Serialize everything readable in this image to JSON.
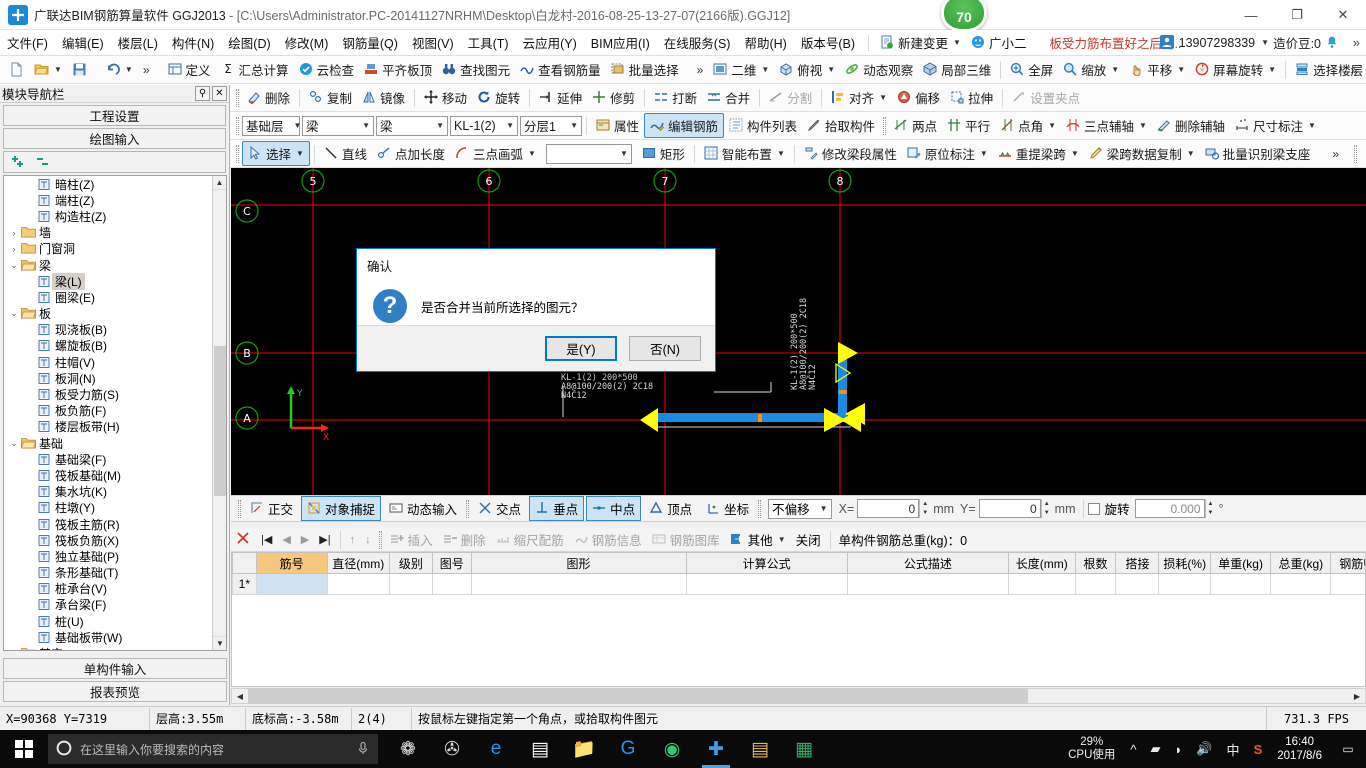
{
  "window": {
    "title_main": "广联达BIM钢筋算量软件 GGJ2013",
    "title_path": " - [C:\\Users\\Administrator.PC-20141127NRHM\\Desktop\\白龙村-2016-08-25-13-27-07(2166版).GGJ12]",
    "minimize": "—",
    "maximize": "❐",
    "close": "✕",
    "score_badge": "70"
  },
  "menu": {
    "items": [
      {
        "label": "文件(F)"
      },
      {
        "label": "编辑(E)"
      },
      {
        "label": "楼层(L)"
      },
      {
        "label": "构件(N)"
      },
      {
        "label": "绘图(D)"
      },
      {
        "label": "修改(M)"
      },
      {
        "label": "钢筋量(Q)"
      },
      {
        "label": "视图(V)"
      },
      {
        "label": "工具(T)"
      },
      {
        "label": "云应用(Y)"
      },
      {
        "label": "BIM应用(I)"
      },
      {
        "label": "在线服务(S)"
      },
      {
        "label": "帮助(H)"
      },
      {
        "label": "版本号(B)"
      }
    ],
    "new_change": "新建变更",
    "user_nick": "广小二",
    "ad_text": "板受力筋布置好之后再..",
    "account_phone": "13907298339",
    "coin_label": "造价豆:0",
    "overflow": "»"
  },
  "toolbar1": {
    "overflow_left": "»",
    "items": [
      {
        "label": "定义",
        "icon": "define-icon"
      },
      {
        "label": "汇总计算",
        "icon": "sigma-icon"
      },
      {
        "label": "云检查",
        "icon": "cloud-check-icon"
      },
      {
        "label": "平齐板顶",
        "icon": "align-slab-icon"
      },
      {
        "label": "查找图元",
        "icon": "binocular-icon"
      },
      {
        "label": "查看钢筋量",
        "icon": "view-rebar-icon"
      },
      {
        "label": "批量选择",
        "icon": "batch-select-icon"
      }
    ],
    "view_items": [
      {
        "label": "二维",
        "icon": "2d-icon",
        "has_caret": true
      },
      {
        "label": "俯视",
        "icon": "topview-icon",
        "has_caret": true
      },
      {
        "label": "动态观察",
        "icon": "orbit-icon",
        "has_caret": false
      },
      {
        "label": "局部三维",
        "icon": "local3d-icon",
        "has_caret": false
      },
      {
        "label": "全屏",
        "icon": "fullscreen-icon",
        "has_caret": false
      },
      {
        "label": "缩放",
        "icon": "zoom-icon",
        "has_caret": true
      },
      {
        "label": "平移",
        "icon": "pan-icon",
        "has_caret": true
      },
      {
        "label": "屏幕旋转",
        "icon": "screen-rotate-icon",
        "has_caret": true
      },
      {
        "label": "选择楼层",
        "icon": "select-floor-icon",
        "has_caret": false
      }
    ],
    "overflow_right": "»"
  },
  "toolbar2": {
    "items": [
      {
        "label": "删除",
        "icon": "delete-icon",
        "disabled": false
      },
      {
        "label": "复制",
        "icon": "copy-icon",
        "disabled": false
      },
      {
        "label": "镜像",
        "icon": "mirror-icon",
        "disabled": false
      },
      {
        "label": "移动",
        "icon": "move-icon",
        "disabled": false
      },
      {
        "label": "旋转",
        "icon": "rotate-icon",
        "disabled": false
      },
      {
        "label": "延伸",
        "icon": "extend-icon",
        "disabled": false
      },
      {
        "label": "修剪",
        "icon": "trim-icon",
        "disabled": false
      },
      {
        "label": "打断",
        "icon": "break-icon",
        "disabled": false
      },
      {
        "label": "合并",
        "icon": "merge-icon",
        "disabled": false
      },
      {
        "label": "分割",
        "icon": "split-icon",
        "disabled": true
      },
      {
        "label": "对齐",
        "icon": "align-icon",
        "disabled": false,
        "has_caret": true
      },
      {
        "label": "偏移",
        "icon": "offset-icon",
        "disabled": false
      },
      {
        "label": "拉伸",
        "icon": "stretch-icon",
        "disabled": false
      },
      {
        "label": "设置夹点",
        "icon": "grip-set-icon",
        "disabled": true
      }
    ]
  },
  "toolbar3": {
    "selects": [
      {
        "name": "floor-select",
        "value": "基础层"
      },
      {
        "name": "category-select",
        "value": "梁"
      },
      {
        "name": "type-select",
        "value": "梁"
      },
      {
        "name": "component-select",
        "value": "KL-1(2)"
      },
      {
        "name": "layer-select",
        "value": "分层1"
      }
    ],
    "items": [
      {
        "label": "属性",
        "icon": "property-icon",
        "active": false
      },
      {
        "label": "编辑钢筋",
        "icon": "edit-rebar-icon",
        "active": true
      },
      {
        "label": "构件列表",
        "icon": "component-list-icon",
        "active": false
      },
      {
        "label": "拾取构件",
        "icon": "pick-component-icon",
        "active": false
      },
      {
        "label": "两点",
        "icon": "two-point-icon",
        "active": false
      },
      {
        "label": "平行",
        "icon": "parallel-icon",
        "active": false
      },
      {
        "label": "点角",
        "icon": "point-angle-icon",
        "active": false,
        "has_caret": true
      },
      {
        "label": "三点辅轴",
        "icon": "three-point-axis-icon",
        "active": false,
        "has_caret": true
      },
      {
        "label": "删除辅轴",
        "icon": "delete-axis-icon",
        "active": false
      },
      {
        "label": "尺寸标注",
        "icon": "dimension-icon",
        "active": false,
        "has_caret": true
      }
    ]
  },
  "toolbar4": {
    "items": [
      {
        "label": "选择",
        "icon": "arrow-select-icon",
        "active": true,
        "has_caret": true
      },
      {
        "label": "直线",
        "icon": "line-icon",
        "active": false
      },
      {
        "label": "点加长度",
        "icon": "point-length-icon",
        "active": false
      },
      {
        "label": "三点画弧",
        "icon": "arc-icon",
        "active": false,
        "has_caret": true
      },
      {
        "label": "矩形",
        "icon": "rect-icon",
        "active": false
      },
      {
        "label": "智能布置",
        "icon": "smart-layout-icon",
        "active": false,
        "has_caret": true
      },
      {
        "label": "修改梁段属性",
        "icon": "edit-beam-seg-icon",
        "active": false
      },
      {
        "label": "原位标注",
        "icon": "insitu-note-icon",
        "active": false,
        "has_caret": true
      },
      {
        "label": "重提梁跨",
        "icon": "respan-beam-icon",
        "active": false,
        "has_caret": true
      },
      {
        "label": "梁跨数据复制",
        "icon": "copy-span-data-icon",
        "active": false,
        "has_caret": true
      },
      {
        "label": "批量识别梁支座",
        "icon": "batch-support-icon",
        "active": false
      }
    ],
    "empty_combo": "",
    "overflow": "»"
  },
  "sidebar": {
    "caption": "模块导航栏",
    "pin": "⚲",
    "close": "✕",
    "buttons": [
      {
        "label": "工程设置",
        "name": "project-settings-button"
      },
      {
        "label": "绘图输入",
        "name": "drawing-input-button"
      }
    ],
    "expand_all": "＋",
    "collapse_all": "－",
    "tree": [
      {
        "label": "暗柱(Z)",
        "depth": 2,
        "type": "leaf",
        "icon": "column-icon"
      },
      {
        "label": "端柱(Z)",
        "depth": 2,
        "type": "leaf",
        "icon": "column-icon"
      },
      {
        "label": "构造柱(Z)",
        "depth": 2,
        "type": "leaf",
        "icon": "constructive-column-icon"
      },
      {
        "label": "墙",
        "depth": 1,
        "type": "folder",
        "expanded": false
      },
      {
        "label": "门窗洞",
        "depth": 1,
        "type": "folder",
        "expanded": false
      },
      {
        "label": "梁",
        "depth": 1,
        "type": "folder",
        "expanded": true
      },
      {
        "label": "梁(L)",
        "depth": 2,
        "type": "leaf",
        "icon": "beam-icon",
        "selected": true
      },
      {
        "label": "圈梁(E)",
        "depth": 2,
        "type": "leaf",
        "icon": "ring-beam-icon"
      },
      {
        "label": "板",
        "depth": 1,
        "type": "folder",
        "expanded": true
      },
      {
        "label": "现浇板(B)",
        "depth": 2,
        "type": "leaf",
        "icon": "slab-icon"
      },
      {
        "label": "螺旋板(B)",
        "depth": 2,
        "type": "leaf",
        "icon": "spiral-slab-icon"
      },
      {
        "label": "柱帽(V)",
        "depth": 2,
        "type": "leaf",
        "icon": "capital-icon"
      },
      {
        "label": "板洞(N)",
        "depth": 2,
        "type": "leaf",
        "icon": "slab-hole-icon"
      },
      {
        "label": "板受力筋(S)",
        "depth": 2,
        "type": "leaf",
        "icon": "slab-rebar-icon"
      },
      {
        "label": "板负筋(F)",
        "depth": 2,
        "type": "leaf",
        "icon": "slab-negative-icon"
      },
      {
        "label": "楼层板带(H)",
        "depth": 2,
        "type": "leaf",
        "icon": "slab-band-icon"
      },
      {
        "label": "基础",
        "depth": 1,
        "type": "folder",
        "expanded": true
      },
      {
        "label": "基础梁(F)",
        "depth": 2,
        "type": "leaf",
        "icon": "found-beam-icon"
      },
      {
        "label": "筏板基础(M)",
        "depth": 2,
        "type": "leaf",
        "icon": "raft-icon"
      },
      {
        "label": "集水坑(K)",
        "depth": 2,
        "type": "leaf",
        "icon": "sump-icon"
      },
      {
        "label": "柱墩(Y)",
        "depth": 2,
        "type": "leaf",
        "icon": "pier-icon"
      },
      {
        "label": "筏板主筋(R)",
        "depth": 2,
        "type": "leaf",
        "icon": "raft-main-icon"
      },
      {
        "label": "筏板负筋(X)",
        "depth": 2,
        "type": "leaf",
        "icon": "raft-neg-icon"
      },
      {
        "label": "独立基础(P)",
        "depth": 2,
        "type": "leaf",
        "icon": "isolated-found-icon"
      },
      {
        "label": "条形基础(T)",
        "depth": 2,
        "type": "leaf",
        "icon": "strip-found-icon"
      },
      {
        "label": "桩承台(V)",
        "depth": 2,
        "type": "leaf",
        "icon": "pile-cap-icon"
      },
      {
        "label": "承台梁(F)",
        "depth": 2,
        "type": "leaf",
        "icon": "cap-beam-icon"
      },
      {
        "label": "桩(U)",
        "depth": 2,
        "type": "leaf",
        "icon": "pile-icon"
      },
      {
        "label": "基础板带(W)",
        "depth": 2,
        "type": "leaf",
        "icon": "found-band-icon"
      },
      {
        "label": "其它",
        "depth": 1,
        "type": "folder",
        "expanded": false
      }
    ],
    "footer_buttons": [
      {
        "label": "单构件输入",
        "name": "single-component-input-button"
      },
      {
        "label": "报表预览",
        "name": "report-preview-button"
      }
    ]
  },
  "canvas": {
    "axis_labels": [
      "5",
      "6",
      "7",
      "8"
    ],
    "row_labels": [
      "C",
      "B",
      "A"
    ],
    "ucs_x": "X",
    "ucs_y": "Y",
    "annotation_main": [
      "KL-1(2)  200*500",
      "A8@100/200(2)  2C18",
      "N4C12"
    ],
    "annotation_vertical": [
      "KL-1(2) 200*500",
      "A8@100/200(2) 2C18",
      "N4C12"
    ]
  },
  "dialog": {
    "title": "确认",
    "icon": "question-icon",
    "message": "是否合并当前所选择的图元？",
    "yes": "是(Y)",
    "no": "否(N)"
  },
  "snapbar": {
    "toggles": [
      {
        "label": "正交",
        "icon": "ortho-icon",
        "active": false
      },
      {
        "label": "对象捕捉",
        "icon": "osnap-icon",
        "active": true
      },
      {
        "label": "动态输入",
        "icon": "dyninput-icon",
        "active": false
      }
    ],
    "snaps": [
      {
        "label": "交点",
        "icon": "intersection-icon",
        "active": false
      },
      {
        "label": "垂点",
        "icon": "perpendicular-icon",
        "active": true
      },
      {
        "label": "中点",
        "icon": "midpoint-icon",
        "active": true
      },
      {
        "label": "顶点",
        "icon": "vertex-icon",
        "active": false
      },
      {
        "label": "坐标",
        "icon": "coordinate-icon",
        "active": false
      }
    ],
    "offset_mode": "不偏移",
    "x_label": "X=",
    "x_value": "0",
    "x_unit": "mm",
    "y_label": "Y=",
    "y_value": "0",
    "y_unit": "mm",
    "rotate_label": "旋转",
    "rotate_value": "0.000",
    "rotate_unit": "°"
  },
  "rebarbar": {
    "items": [
      {
        "label": "插入",
        "icon": "insert-row-icon",
        "disabled": true
      },
      {
        "label": "删除",
        "icon": "delete-row-icon",
        "disabled": true
      },
      {
        "label": "缩尺配筋",
        "icon": "scale-rebar-icon",
        "disabled": true
      },
      {
        "label": "钢筋信息",
        "icon": "rebar-info-icon",
        "disabled": true
      },
      {
        "label": "钢筋图库",
        "icon": "rebar-lib-icon",
        "disabled": true
      },
      {
        "label": "其他",
        "icon": "other-icon",
        "disabled": false,
        "has_caret": true
      },
      {
        "label": "关闭",
        "icon": "",
        "disabled": false
      }
    ],
    "total_label": "单构件钢筋总重(kg)：0"
  },
  "rebar_table": {
    "columns": [
      "筋号",
      "直径(mm)",
      "级别",
      "图号",
      "图形",
      "计算公式",
      "公式描述",
      "长度(mm)",
      "根数",
      "搭接",
      "损耗(%)",
      "单重(kg)",
      "总重(kg)",
      "钢筋归类"
    ],
    "rows": [
      {
        "index": "1*",
        "cells": [
          "",
          "",
          "",
          "",
          "",
          "",
          "",
          "",
          "",
          "",
          "",
          "",
          "",
          ""
        ]
      }
    ]
  },
  "statusbar": {
    "coords": "X=90368  Y=7319",
    "floor_height": "层高:3.55m",
    "base_elev": "底标高:-3.58m",
    "counter": "2(4)",
    "hint": "按鼠标左键指定第一个角点，或拾取构件图元",
    "fps": "731.3 FPS"
  },
  "taskbar": {
    "search_placeholder": "在这里输入你要搜索的内容",
    "apps": [
      {
        "name": "taskbar-app-fan",
        "glyph": "❁"
      },
      {
        "name": "taskbar-app-spiral",
        "glyph": "✇"
      },
      {
        "name": "taskbar-app-edge",
        "glyph": "e"
      },
      {
        "name": "taskbar-app-store",
        "glyph": "▤"
      },
      {
        "name": "taskbar-app-explorer",
        "glyph": "📁"
      },
      {
        "name": "taskbar-app-glodon",
        "glyph": "G"
      },
      {
        "name": "taskbar-app-browser",
        "glyph": "◉"
      },
      {
        "name": "taskbar-app-ggj",
        "glyph": "✚"
      },
      {
        "name": "taskbar-app-note",
        "glyph": "▤"
      },
      {
        "name": "taskbar-app-calc",
        "glyph": "▦"
      }
    ],
    "cpu_percent": "29%",
    "cpu_label": "CPU使用",
    "tray": [
      {
        "name": "tray-chevron-icon",
        "glyph": "^"
      },
      {
        "name": "tray-battery-icon",
        "glyph": "▰"
      },
      {
        "name": "tray-wifi-icon",
        "glyph": "◗"
      },
      {
        "name": "tray-volume-icon",
        "glyph": "🔊"
      },
      {
        "name": "tray-ime-icon",
        "glyph": "中"
      },
      {
        "name": "tray-sogou-icon",
        "glyph": "S"
      }
    ],
    "clock_time": "16:40",
    "clock_date": "2017/8/6",
    "notification": "▭"
  },
  "colors": {
    "accent": "#0078d7",
    "beam_blue": "#1b8ae0",
    "axis_red": "#ff0000",
    "highlight_yellow": "#ffff00",
    "header_orange": "#f7c77e"
  }
}
